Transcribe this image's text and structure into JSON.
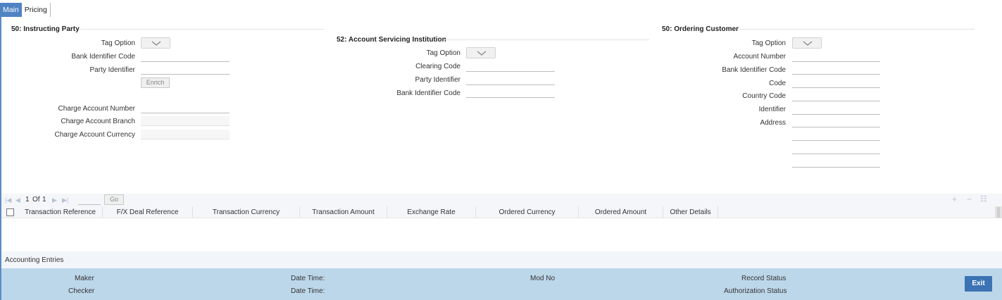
{
  "tabs": {
    "main": "Main",
    "pricing": "Pricing"
  },
  "instructing_party": {
    "title": "50: Instructing Party",
    "tag_option": "Tag Option",
    "bic": "Bank Identifier Code",
    "party_identifier": "Party Identifier",
    "enrich": "Enrich",
    "charge_account_number": "Charge Account Number",
    "charge_account_branch": "Charge Account Branch",
    "charge_account_currency": "Charge Account Currency"
  },
  "account_servicing": {
    "title": "52: Account Servicing Institution",
    "tag_option": "Tag Option",
    "clearing_code": "Clearing Code",
    "party_identifier": "Party Identifier",
    "bic": "Bank Identifier Code"
  },
  "ordering_customer": {
    "title": "50: Ordering Customer",
    "tag_option": "Tag Option",
    "account_number": "Account Number",
    "bic": "Bank Identifier Code",
    "code": "Code",
    "country_code": "Country Code",
    "identifier": "Identifier",
    "address": "Address"
  },
  "grid": {
    "page_current": "1",
    "page_of": "Of",
    "page_total": "1",
    "go": "Go",
    "columns": [
      "Transaction Reference",
      "F/X Deal Reference",
      "Transaction Currency",
      "Transaction Amount",
      "Exchange Rate",
      "Ordered Currency",
      "Ordered Amount",
      "Other Details"
    ]
  },
  "accounting_entries": "Accounting Entries",
  "footer": {
    "maker": "Maker",
    "checker": "Checker",
    "date_time_1": "Date Time:",
    "date_time_2": "Date Time:",
    "mod_no": "Mod No",
    "record_status": "Record Status",
    "authorization_status": "Authorization Status",
    "exit": "Exit"
  },
  "icons": {
    "first_page": "first-page-icon",
    "prev_page": "prev-page-icon",
    "next_page": "next-page-icon",
    "last_page": "last-page-icon",
    "add_row": "plus-icon",
    "delete_row": "minus-icon",
    "single_view": "list-icon",
    "dropdown": "chevron-down-icon"
  },
  "colors": {
    "tab_active": "#4f83c3",
    "footer_bg": "#bdd7ea",
    "exit_button": "#3c73b4"
  }
}
